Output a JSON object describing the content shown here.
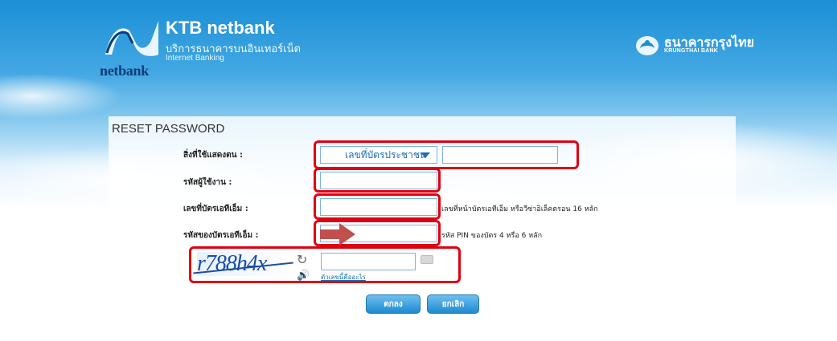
{
  "header": {
    "brand_title": "KTB netbank",
    "brand_subtitle_th": "บริการธนาคารบนอินเทอร์เน็ต",
    "brand_subtitle_en": "Internet Banking",
    "logo_word": "netbank",
    "bank_name_th": "ธนาคารกรุงไทย",
    "bank_name_en": "KRUNGTHAI BANK"
  },
  "form": {
    "title": "RESET PASSWORD",
    "id_type": {
      "label": "สิ่งที่ใช้แสดงตน :",
      "selected_option": "เลขที่บัตรประชาชน",
      "value": ""
    },
    "username": {
      "label": "รหัสผู้ใช้งาน :",
      "value": ""
    },
    "atm_card": {
      "label": "เลขที่บัตรเอทีเอ็ม :",
      "value": "",
      "hint": "เลขที่หน้าบัตรเอทีเอ็ม หรือวีซ่าอิเล็คตรอน 16 หลัก"
    },
    "atm_pin": {
      "label": "รหัสของบัตรเอทีเอ็ม :",
      "value": "",
      "hint": "รหัส PIN ของบัตร 4 หรือ 6 หลัก"
    },
    "captcha": {
      "text": "r788h4x",
      "input_value": "",
      "help_link": "ตัวเลขนี้คืออะไร"
    },
    "ok_button": "ตกลง",
    "cancel_button": "ยกเลิก"
  },
  "icons": {
    "refresh": "refresh-icon",
    "audio": "speaker-icon",
    "keyboard": "keyboard-icon"
  },
  "colors": {
    "highlight_red": "#e00010",
    "accent_blue": "#1a6fb5",
    "arrow": "#c0504d"
  }
}
